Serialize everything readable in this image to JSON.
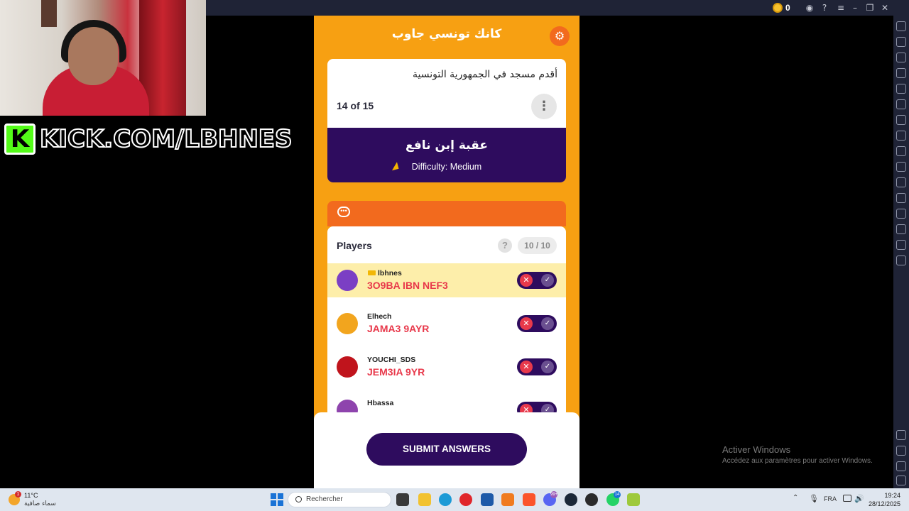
{
  "emulator": {
    "coin_count": "0"
  },
  "stream": {
    "banner_text": "KICK.COM/LBHNES",
    "logo_letter": "K"
  },
  "game": {
    "title": "كانك تونسي جاوب",
    "question": "أقدم مسجد في الجمهورية التونسية",
    "progress": "14 of 15",
    "answer": "عقبة إبن نافع",
    "difficulty": "Difficulty: Medium",
    "players_title": "Players",
    "players_count": "10 / 10",
    "help_glyph": "?",
    "submit_label": "SUBMIT ANSWERS",
    "players": [
      {
        "name": "lbhnes",
        "answer": "3O9BA IBN NEF3",
        "crown": true,
        "highlight": true,
        "avatar_color": "#7b3fc4"
      },
      {
        "name": "Elhech",
        "answer": "JAMA3 9AYR",
        "crown": false,
        "highlight": false,
        "avatar_color": "#f2a51e"
      },
      {
        "name": "YOUCHI_SDS",
        "answer": "JEM3IA 9YR",
        "crown": false,
        "highlight": false,
        "avatar_color": "#c0141c"
      },
      {
        "name": "Hbassa",
        "answer": "",
        "crown": false,
        "highlight": false,
        "avatar_color": "#8e44ad"
      }
    ]
  },
  "watermark": {
    "title": "Activer Windows",
    "subtitle": "Accédez aux paramètres pour activer Windows."
  },
  "taskbar": {
    "weather_temp": "11°C",
    "weather_desc": "سماء صافية",
    "weather_badge": "1",
    "search_placeholder": "Rechercher",
    "language": "FRA",
    "time": "19:24",
    "date": "28/12/2025",
    "badge_discord": "99+",
    "badge_whatsapp": "14"
  },
  "colors": {
    "game_bg": "#f7a012",
    "accent_purple": "#2e0c5e",
    "answer_red": "#e8394b",
    "highlight_row": "#fdeeaa",
    "chat_bar": "#f26a1e"
  }
}
